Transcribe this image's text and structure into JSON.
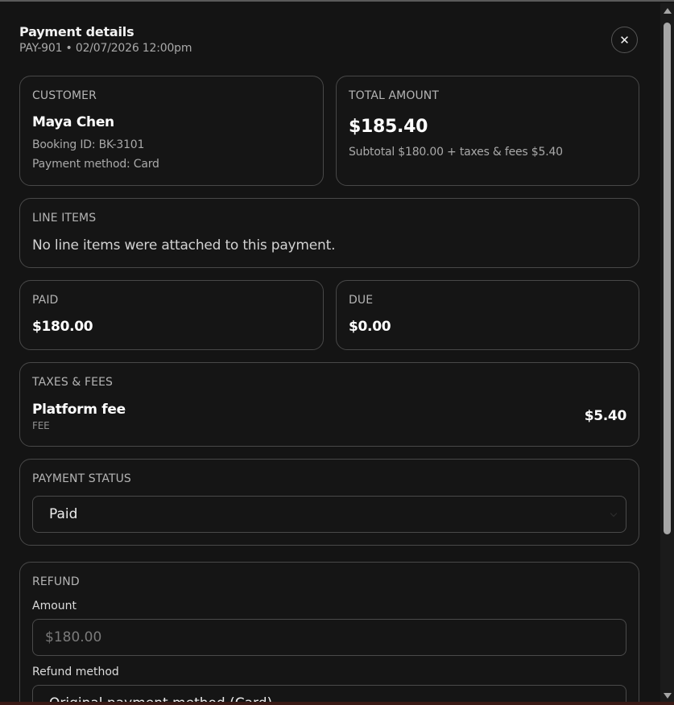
{
  "header": {
    "title": "Payment details",
    "subtitle": "PAY-901 • 02/07/2026 12:00pm",
    "close_glyph": "✕"
  },
  "customer": {
    "label": "CUSTOMER",
    "name": "Maya Chen",
    "booking": "Booking ID: BK-3101",
    "method": "Payment method: Card"
  },
  "total": {
    "label": "TOTAL AMOUNT",
    "amount": "$185.40",
    "breakdown": "Subtotal $180.00 + taxes & fees $5.40"
  },
  "line_items": {
    "label": "LINE ITEMS",
    "empty": "No line items were attached to this payment."
  },
  "paid": {
    "label": "PAID",
    "amount": "$180.00"
  },
  "due": {
    "label": "DUE",
    "amount": "$0.00"
  },
  "taxes": {
    "label": "TAXES & FEES",
    "name": "Platform fee",
    "type": "FEE",
    "amount": "$5.40"
  },
  "payment_status": {
    "label": "PAYMENT STATUS",
    "value": "Paid"
  },
  "refund": {
    "label": "REFUND",
    "amount_label": "Amount",
    "amount_placeholder": "$180.00",
    "method_label": "Refund method",
    "method_value": "Original payment method (Card)"
  },
  "colors": {
    "background": "#141414",
    "card_border": "#484848",
    "text": "#f2f2f2",
    "muted": "#a9a9a9"
  },
  "icons": [
    "close-icon",
    "chevron-down-icon",
    "scroll-up-icon",
    "scroll-down-icon"
  ]
}
